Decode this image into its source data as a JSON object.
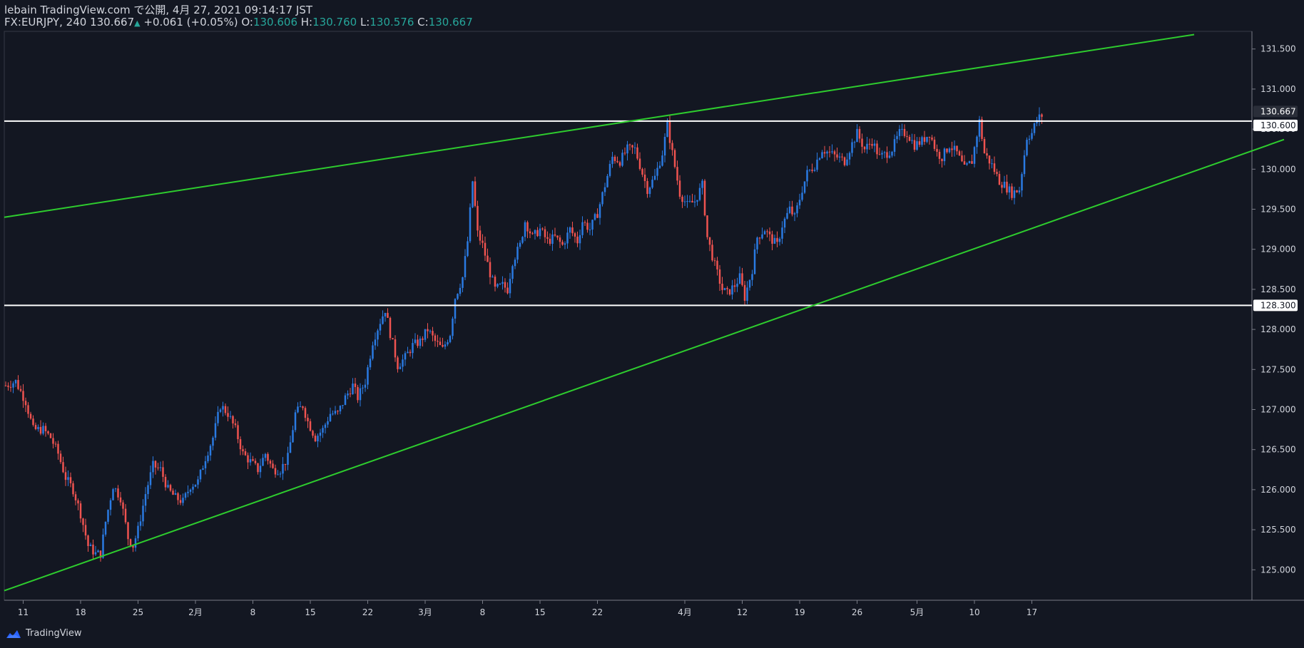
{
  "header": {
    "line1": "lebain TradingView.com で公開, 4月 27, 2021 09:14:17 JST",
    "symbol_info": "FX:EURJPY, 240",
    "last": "130.667",
    "change_arrow": "▲",
    "change": "+0.061 (+0.05%)",
    "o_label": "O:",
    "o_value": "130.606",
    "h_label": "H:",
    "h_value": "130.760",
    "l_label": "L:",
    "l_value": "130.576",
    "c_label": "C:",
    "c_value": "130.667"
  },
  "footer": {
    "brand": "TradingView"
  },
  "colors": {
    "background": "#131722",
    "up_candle": "#2a7ae2",
    "down_candle": "#ef5350",
    "trendline": "#2ecc2e",
    "level_line": "#ffffff",
    "axis_text": "#d1d4dc",
    "last_price_bg": "#2a2e39"
  },
  "chart_data": {
    "type": "candlestick",
    "ylim": [
      124.62,
      131.72
    ],
    "y_ticks": [
      "125.000",
      "125.500",
      "126.000",
      "126.500",
      "127.000",
      "127.500",
      "128.000",
      "128.500",
      "129.000",
      "129.500",
      "130.000",
      "130.500",
      "131.000",
      "131.500"
    ],
    "x_ticks": [
      "11",
      "18",
      "25",
      "2月",
      "8",
      "15",
      "22",
      "3月",
      "8",
      "15",
      "22",
      "4月",
      "12",
      "19",
      "26",
      "5月",
      "10",
      "17"
    ],
    "price_labels": [
      {
        "text": "130.667",
        "price": 130.667,
        "kind": "last"
      },
      {
        "text": "130.600",
        "price": 130.6,
        "kind": "level"
      },
      {
        "text": "128.300",
        "price": 128.3,
        "kind": "level"
      }
    ],
    "horizontal_levels": [
      130.6,
      128.3
    ],
    "close_path": [
      [
        0,
        127.3
      ],
      [
        4,
        127.35
      ],
      [
        8,
        127.1
      ],
      [
        11,
        126.75
      ],
      [
        15,
        126.75
      ],
      [
        18,
        126.65
      ],
      [
        21,
        126.45
      ],
      [
        24,
        126.15
      ],
      [
        27,
        126.0
      ],
      [
        30,
        125.7
      ],
      [
        33,
        125.3
      ],
      [
        36,
        125.2
      ],
      [
        38,
        125.2
      ],
      [
        40,
        125.6
      ],
      [
        43,
        126.05
      ],
      [
        46,
        125.9
      ],
      [
        49,
        125.4
      ],
      [
        51,
        125.3
      ],
      [
        53,
        125.5
      ],
      [
        56,
        125.95
      ],
      [
        59,
        126.3
      ],
      [
        62,
        126.25
      ],
      [
        65,
        126.0
      ],
      [
        68,
        125.9
      ],
      [
        71,
        125.85
      ],
      [
        74,
        126.05
      ],
      [
        77,
        126.1
      ],
      [
        80,
        126.4
      ],
      [
        83,
        126.65
      ],
      [
        86,
        127.05
      ],
      [
        89,
        126.95
      ],
      [
        92,
        126.75
      ],
      [
        95,
        126.45
      ],
      [
        98,
        126.35
      ],
      [
        101,
        126.25
      ],
      [
        104,
        126.45
      ],
      [
        107,
        126.25
      ],
      [
        110,
        126.25
      ],
      [
        113,
        126.4
      ],
      [
        116,
        126.95
      ],
      [
        119,
        127.05
      ],
      [
        121,
        126.85
      ],
      [
        124,
        126.65
      ],
      [
        127,
        126.75
      ],
      [
        130,
        126.95
      ],
      [
        133,
        126.95
      ],
      [
        136,
        127.15
      ],
      [
        139,
        127.3
      ],
      [
        141,
        127.15
      ],
      [
        144,
        127.35
      ],
      [
        147,
        127.85
      ],
      [
        150,
        128.1
      ],
      [
        152,
        128.25
      ],
      [
        154,
        127.95
      ],
      [
        157,
        127.55
      ],
      [
        160,
        127.65
      ],
      [
        163,
        127.8
      ],
      [
        166,
        127.85
      ],
      [
        169,
        128.0
      ],
      [
        172,
        127.85
      ],
      [
        175,
        127.75
      ],
      [
        178,
        127.95
      ],
      [
        180,
        128.4
      ],
      [
        183,
        128.65
      ],
      [
        185,
        129.1
      ],
      [
        187,
        129.85
      ],
      [
        189,
        129.2
      ],
      [
        191,
        129.05
      ],
      [
        194,
        128.7
      ],
      [
        196,
        128.5
      ],
      [
        199,
        128.55
      ],
      [
        201,
        128.5
      ],
      [
        203,
        128.85
      ],
      [
        206,
        129.05
      ],
      [
        208,
        129.35
      ],
      [
        211,
        129.15
      ],
      [
        214,
        129.25
      ],
      [
        217,
        129.1
      ],
      [
        220,
        129.15
      ],
      [
        223,
        129.05
      ],
      [
        226,
        129.25
      ],
      [
        229,
        129.1
      ],
      [
        231,
        129.35
      ],
      [
        234,
        129.25
      ],
      [
        237,
        129.45
      ],
      [
        240,
        129.8
      ],
      [
        243,
        130.15
      ],
      [
        246,
        130.1
      ],
      [
        249,
        130.25
      ],
      [
        252,
        130.25
      ],
      [
        254,
        130.05
      ],
      [
        257,
        129.75
      ],
      [
        260,
        129.9
      ],
      [
        263,
        130.2
      ],
      [
        265,
        130.55
      ],
      [
        267,
        130.2
      ],
      [
        270,
        129.7
      ],
      [
        273,
        129.55
      ],
      [
        276,
        129.6
      ],
      [
        279,
        129.8
      ],
      [
        281,
        129.15
      ],
      [
        284,
        128.8
      ],
      [
        287,
        128.5
      ],
      [
        289,
        128.45
      ],
      [
        292,
        128.55
      ],
      [
        294,
        128.65
      ],
      [
        296,
        128.4
      ],
      [
        299,
        128.75
      ],
      [
        301,
        129.15
      ],
      [
        304,
        129.25
      ],
      [
        306,
        129.15
      ],
      [
        309,
        129.05
      ],
      [
        311,
        129.3
      ],
      [
        314,
        129.5
      ],
      [
        316,
        129.4
      ],
      [
        319,
        129.75
      ],
      [
        321,
        129.95
      ],
      [
        324,
        130.05
      ],
      [
        327,
        130.25
      ],
      [
        330,
        130.2
      ],
      [
        333,
        130.15
      ],
      [
        336,
        130.1
      ],
      [
        338,
        130.25
      ],
      [
        341,
        130.45
      ],
      [
        344,
        130.25
      ],
      [
        347,
        130.35
      ],
      [
        350,
        130.15
      ],
      [
        353,
        130.2
      ],
      [
        355,
        130.25
      ],
      [
        358,
        130.45
      ],
      [
        361,
        130.45
      ],
      [
        364,
        130.3
      ],
      [
        367,
        130.35
      ],
      [
        370,
        130.45
      ],
      [
        373,
        130.2
      ],
      [
        375,
        130.15
      ],
      [
        378,
        130.3
      ],
      [
        381,
        130.2
      ],
      [
        384,
        130.0
      ],
      [
        387,
        130.1
      ],
      [
        390,
        130.6
      ],
      [
        392,
        130.2
      ],
      [
        395,
        130.05
      ],
      [
        398,
        129.85
      ],
      [
        400,
        129.8
      ],
      [
        403,
        129.7
      ],
      [
        406,
        129.75
      ],
      [
        409,
        130.4
      ],
      [
        411,
        130.45
      ],
      [
        413,
        130.62
      ],
      [
        415,
        130.67
      ]
    ],
    "trendlines": [
      {
        "name": "upper",
        "x0": 0,
        "y0": 129.4,
        "x1": 476,
        "y1": 131.68
      },
      {
        "name": "lower",
        "x0": 0,
        "y0": 124.74,
        "x1": 512,
        "y1": 130.37
      }
    ]
  }
}
